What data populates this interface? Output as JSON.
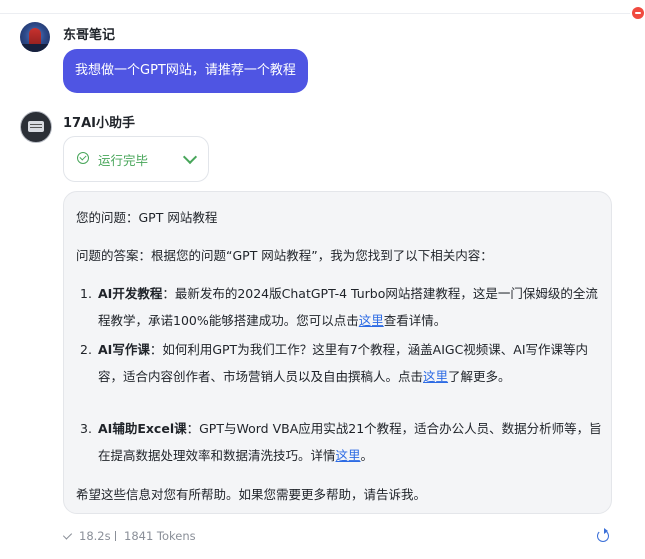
{
  "user": {
    "name": "东哥笔记",
    "message": "我想做一个GPT网站，请推荐一个教程"
  },
  "bot": {
    "name": "17AI小助手",
    "status": "运行完毕",
    "question_line": "您的问题：GPT 网站教程",
    "intro_line": "问题的答案：根据您的问题“GPT 网站教程”，我为您找到了以下相关内容：",
    "items": [
      {
        "num": "1.",
        "title": "AI开发教程",
        "text": "：最新发布的2024版ChatGPT-4 Turbo网站搭建教程，这是一门保姆级的全流程教学，承诺100%能够搭建成功。您可以点击",
        "link": "这里",
        "after": "查看详情。"
      },
      {
        "num": "2.",
        "title": "AI写作课",
        "text": "：如何利用GPT为我们工作？这里有7个教程，涵盖AIGC视频课、AI写作课等内容，适合内容创作者、市场营销人员以及自由撰稿人。点击",
        "link": "这里",
        "after": "了解更多。"
      },
      {
        "num": "3.",
        "title": "AI辅助Excel课",
        "text": "：GPT与Word VBA应用实战21个教程，适合办公人员、数据分析师等，旨在提高数据处理效率和数据清洗技巧。详情",
        "link": "这里",
        "after": "。"
      }
    ],
    "closing_line": "希望这些信息对您有所帮助。如果您需要更多帮助，请告诉我。"
  },
  "footer": {
    "time": "18.2s",
    "tokens": "1841 Tokens"
  },
  "colors": {
    "accent": "#4f55e3",
    "success": "#48a65a",
    "link": "#2d6be4",
    "danger": "#f04a3f"
  },
  "icons": [
    "remove-icon",
    "check-circle-icon",
    "chevron-down-icon",
    "check-icon",
    "refresh-icon"
  ]
}
